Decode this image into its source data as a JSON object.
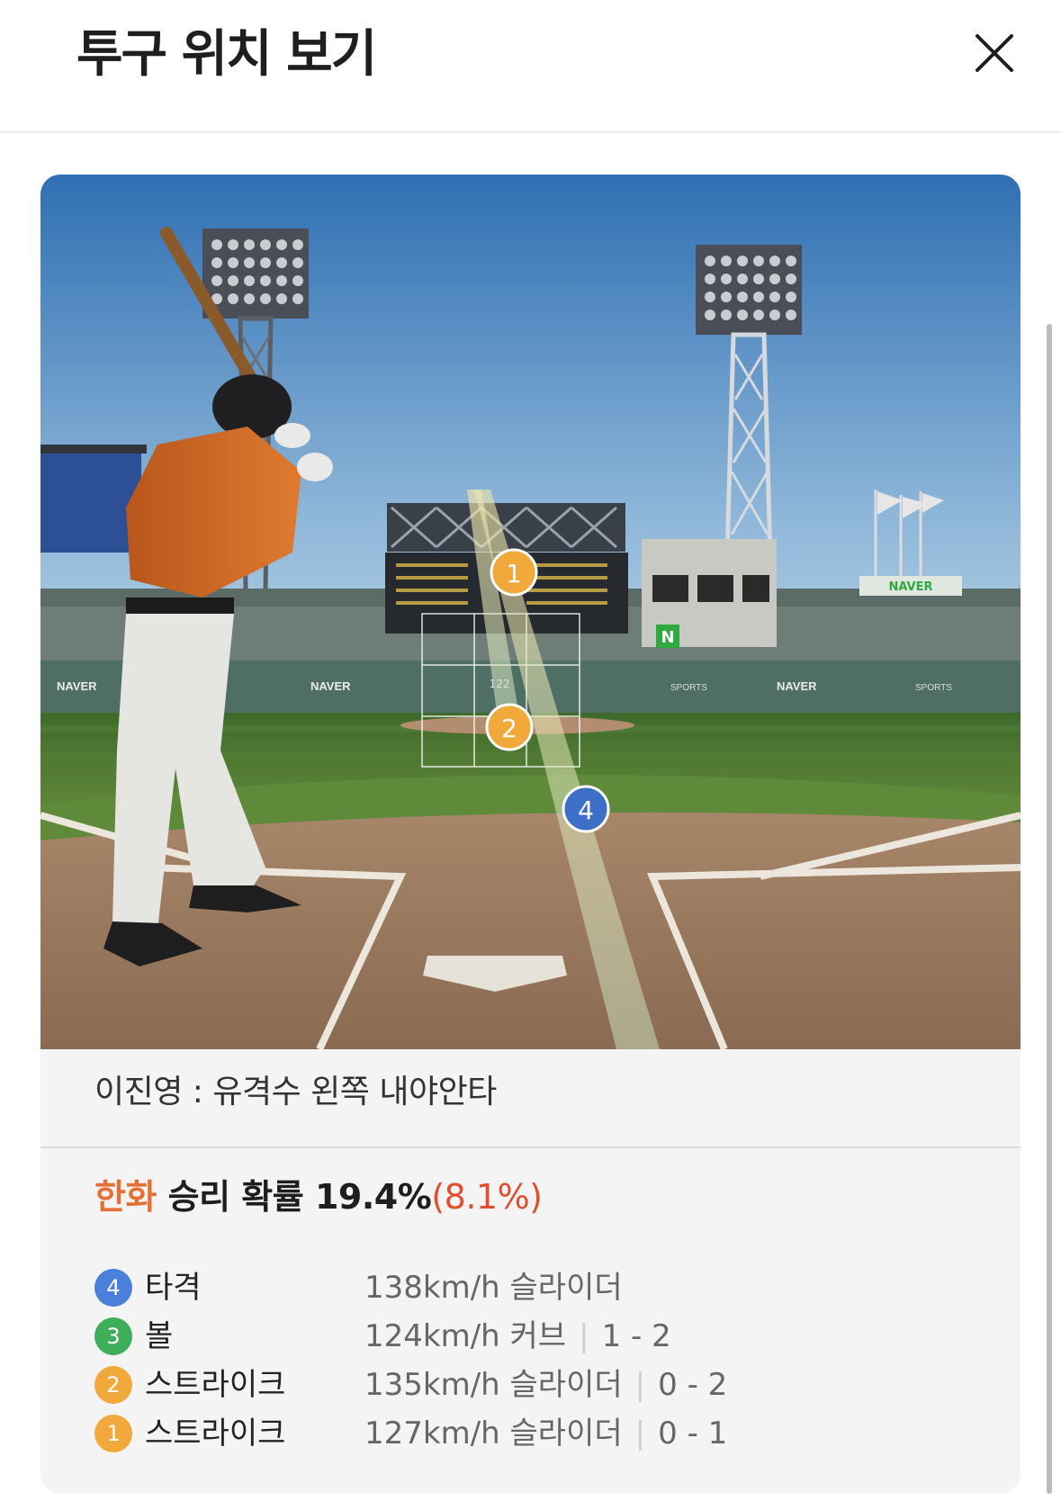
{
  "header": {
    "title": "투구 위치 보기",
    "close_icon": "close-icon"
  },
  "scene": {
    "ad_text": "NAVER",
    "sports_text": "SPORTS",
    "n_logo": "N",
    "speed_readout": "122",
    "markers": [
      {
        "number": "1",
        "color": "#f2a93b"
      },
      {
        "number": "2",
        "color": "#f2a93b"
      },
      {
        "number": "4",
        "color": "#3d6fc9"
      }
    ]
  },
  "play_result": "이진영 : 유격수 왼쪽 내야안타",
  "win_probability": {
    "team": "한화",
    "label": "승리 확률",
    "value": "19.4%",
    "change": "(8.1%)"
  },
  "pitches": [
    {
      "number": "4",
      "color": "#4a7fdc",
      "type": "타격",
      "speed": "138km/h",
      "pitch": "슬라이더",
      "count": ""
    },
    {
      "number": "3",
      "color": "#3fae5a",
      "type": "볼",
      "speed": "124km/h",
      "pitch": "커브",
      "count": "1 - 2"
    },
    {
      "number": "2",
      "color": "#f2a93b",
      "type": "스트라이크",
      "speed": "135km/h",
      "pitch": "슬라이더",
      "count": "0 - 2"
    },
    {
      "number": "1",
      "color": "#f2a93b",
      "type": "스트라이크",
      "speed": "127km/h",
      "pitch": "슬라이더",
      "count": "0 - 1"
    }
  ]
}
